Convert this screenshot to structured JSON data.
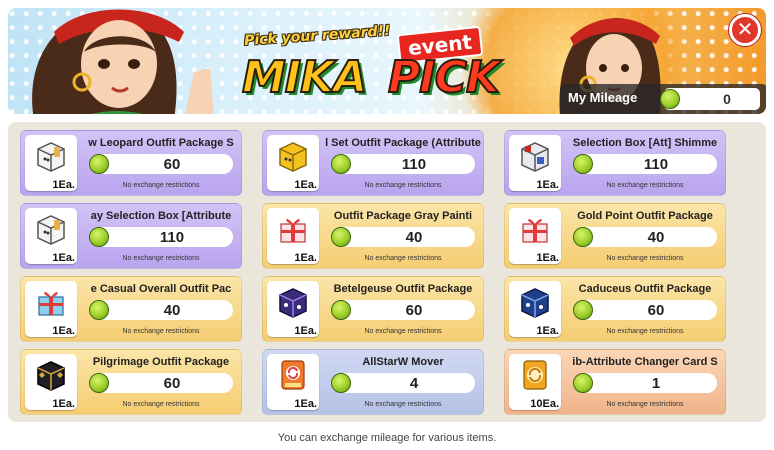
{
  "header": {
    "tagline": "Pick your reward!!",
    "event_tag": "event",
    "logo_left": "MIKA",
    "logo_right": "PICK",
    "close_symbol": "✕"
  },
  "mileage": {
    "label": "My Mileage",
    "value": "0"
  },
  "currency_icon": "green-coin-icon",
  "items": [
    {
      "title": "w Leopard Outfit Package   S",
      "price": "60",
      "qty": "1Ea.",
      "note": "No exchange restrictions",
      "theme": "purple",
      "icon": "white-box-icon"
    },
    {
      "title": "l Set Outfit Package (Attribute",
      "price": "110",
      "qty": "1Ea.",
      "note": "No exchange restrictions",
      "theme": "purple",
      "icon": "yellow-box-icon"
    },
    {
      "title": "Selection Box    [Att] Shimme",
      "price": "110",
      "qty": "1Ea.",
      "note": "No exchange restrictions",
      "theme": "purple",
      "icon": "selection-box-icon"
    },
    {
      "title": "ay Selection Box    [Attribute",
      "price": "110",
      "qty": "1Ea.",
      "note": "No exchange restrictions",
      "theme": "purple",
      "icon": "white-box-icon"
    },
    {
      "title": "Outfit Package    Gray Painti",
      "price": "40",
      "qty": "1Ea.",
      "note": "No exchange restrictions",
      "theme": "yellow",
      "icon": "gift-box-icon"
    },
    {
      "title": "Gold Point Outfit Package",
      "price": "40",
      "qty": "1Ea.",
      "note": "No exchange restrictions",
      "theme": "yellow",
      "icon": "gift-box-icon"
    },
    {
      "title": "e    Casual Overall Outfit Pac",
      "price": "40",
      "qty": "1Ea.",
      "note": "No exchange restrictions",
      "theme": "yellow",
      "icon": "blue-gift-box-icon"
    },
    {
      "title": "Betelgeuse Outfit Package",
      "price": "60",
      "qty": "1Ea.",
      "note": "No exchange restrictions",
      "theme": "yellow",
      "icon": "dark-purple-box-icon"
    },
    {
      "title": "Caduceus Outfit Package",
      "price": "60",
      "qty": "1Ea.",
      "note": "No exchange restrictions",
      "theme": "yellow",
      "icon": "dark-blue-box-icon"
    },
    {
      "title": "Pilgrimage Outfit Package",
      "price": "60",
      "qty": "1Ea.",
      "note": "No exchange restrictions",
      "theme": "yellow",
      "icon": "black-gold-box-icon"
    },
    {
      "title": "AllStarW Mover",
      "price": "4",
      "qty": "1Ea.",
      "note": "No exchange restrictions",
      "theme": "blue",
      "icon": "mover-card-icon"
    },
    {
      "title": "ib-Attribute Changer    Card S",
      "price": "1",
      "qty": "10Ea.",
      "note": "No exchange restrictions",
      "theme": "orange",
      "icon": "attribute-card-icon"
    }
  ],
  "footer": {
    "note": "You can exchange mileage for various items."
  }
}
